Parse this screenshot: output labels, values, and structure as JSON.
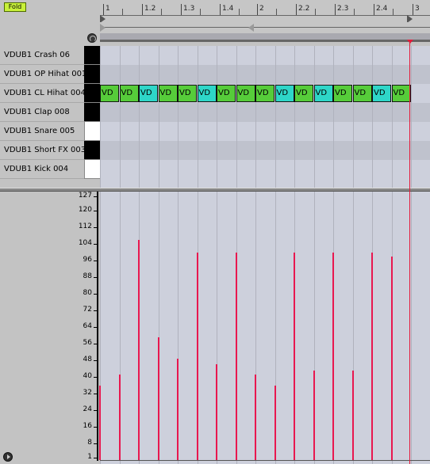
{
  "header": {
    "fold_label": "Fold"
  },
  "ruler": {
    "bars": [
      "1",
      "1.2",
      "1.3",
      "1.4",
      "2",
      "2.2",
      "2.3",
      "2.4",
      "3"
    ]
  },
  "tracks": [
    {
      "name": "VDUB1 Crash 06",
      "key": "black"
    },
    {
      "name": "VDUB1 OP Hihat 001",
      "key": "black"
    },
    {
      "name": "VDUB1 CL Hihat 004",
      "key": "black"
    },
    {
      "name": "VDUB1 Clap 008",
      "key": "black"
    },
    {
      "name": "VDUB1 Snare 005",
      "key": "white"
    },
    {
      "name": "VDUB1 Short FX 003",
      "key": "black"
    },
    {
      "name": "VDUB1 Kick 004",
      "key": "white"
    }
  ],
  "notes": {
    "track": "VDUB1 CL Hihat 004",
    "label": "VD",
    "colors": [
      "green",
      "green",
      "cyan",
      "green",
      "green",
      "cyan",
      "green",
      "green",
      "green",
      "cyan",
      "green",
      "cyan",
      "green",
      "green",
      "cyan",
      "green"
    ],
    "velocities": [
      36,
      41,
      106,
      59,
      49,
      100,
      46,
      100,
      41,
      36,
      100,
      43,
      100,
      43,
      100,
      98
    ]
  },
  "velocity_axis": {
    "labels": [
      "127",
      "120",
      "112",
      "104",
      "96",
      "88",
      "80",
      "72",
      "64",
      "56",
      "48",
      "40",
      "32",
      "24",
      "16",
      "8",
      "1"
    ],
    "values": [
      127,
      120,
      112,
      104,
      96,
      88,
      80,
      72,
      64,
      56,
      48,
      40,
      32,
      24,
      16,
      8,
      1
    ]
  },
  "colors": {
    "accent": "#e8174f",
    "note_green": "#56cc3a",
    "note_cyan": "#2ed6c8",
    "fold_button": "#c8f03a"
  }
}
